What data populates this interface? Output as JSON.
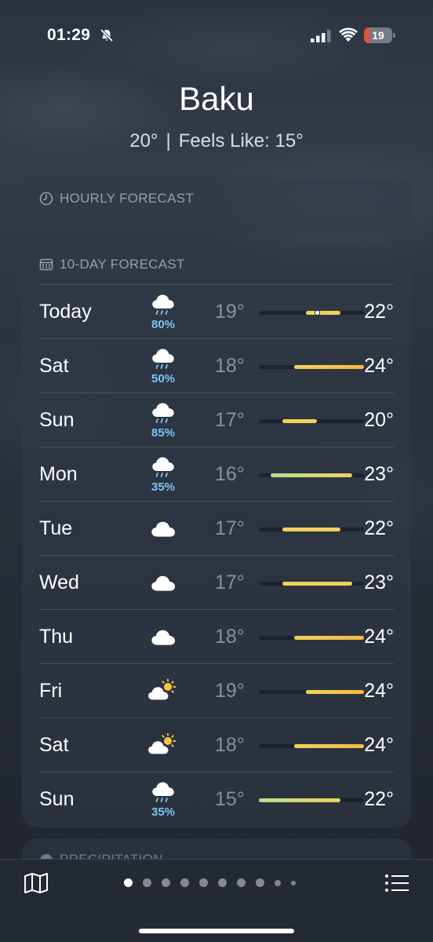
{
  "status_bar": {
    "time": "01:29",
    "battery_level": "19",
    "battery_fraction": 0.19,
    "colors": {
      "battery_low": "#eb4d3d"
    }
  },
  "location": {
    "city": "Baku",
    "current_temp": "20°",
    "separator": "|",
    "feels_like": "Feels Like: 15°"
  },
  "hourly": {
    "title": "HOURLY FORECAST",
    "icon": "clock-icon"
  },
  "ten_day": {
    "title": "10-DAY FORECAST",
    "icon": "calendar-icon",
    "range_min": 15,
    "range_max": 24,
    "rows": [
      {
        "day": "Today",
        "icon": "rain-icon",
        "pop": "80%",
        "low_text": "19°",
        "high_text": "22°",
        "low": 19,
        "high": 22,
        "current": 20
      },
      {
        "day": "Sat",
        "icon": "rain-icon",
        "pop": "50%",
        "low_text": "18°",
        "high_text": "24°",
        "low": 18,
        "high": 24
      },
      {
        "day": "Sun",
        "icon": "rain-icon",
        "pop": "85%",
        "low_text": "17°",
        "high_text": "20°",
        "low": 17,
        "high": 20
      },
      {
        "day": "Mon",
        "icon": "rain-icon",
        "pop": "35%",
        "low_text": "16°",
        "high_text": "23°",
        "low": 16,
        "high": 23
      },
      {
        "day": "Tue",
        "icon": "cloud-icon",
        "pop": "",
        "low_text": "17°",
        "high_text": "22°",
        "low": 17,
        "high": 22
      },
      {
        "day": "Wed",
        "icon": "cloud-icon",
        "pop": "",
        "low_text": "17°",
        "high_text": "23°",
        "low": 17,
        "high": 23
      },
      {
        "day": "Thu",
        "icon": "cloud-icon",
        "pop": "",
        "low_text": "18°",
        "high_text": "24°",
        "low": 18,
        "high": 24
      },
      {
        "day": "Fri",
        "icon": "partly-sunny-icon",
        "pop": "",
        "low_text": "19°",
        "high_text": "24°",
        "low": 19,
        "high": 24
      },
      {
        "day": "Sat",
        "icon": "partly-sunny-icon",
        "pop": "",
        "low_text": "18°",
        "high_text": "24°",
        "low": 18,
        "high": 24
      },
      {
        "day": "Sun",
        "icon": "rain-icon",
        "pop": "35%",
        "low_text": "15°",
        "high_text": "22°",
        "low": 15,
        "high": 22
      }
    ],
    "colors": {
      "pop": "#7ec4f5",
      "bar_cool": "#b9dc92",
      "bar_mid": "#eed35a",
      "bar_warm": "#f5b942"
    }
  },
  "precipitation": {
    "title": "PRECIPITATION"
  },
  "bottom_bar": {
    "map_icon": "map-icon",
    "list_icon": "list-icon",
    "page_count": 10,
    "active_page": 0
  }
}
